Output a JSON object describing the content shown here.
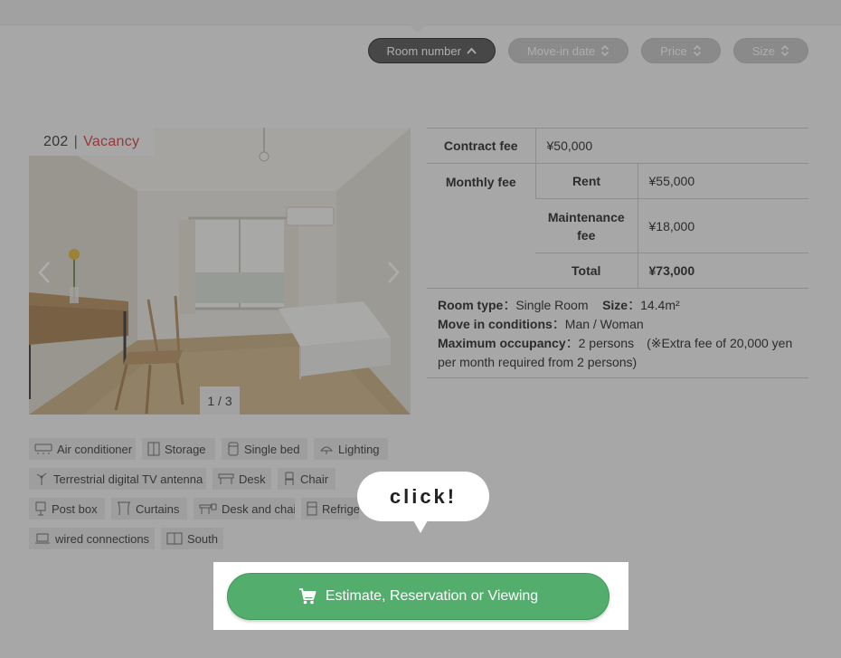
{
  "sort": {
    "items": [
      {
        "label": "Room number",
        "active": true
      },
      {
        "label": "Move-in date",
        "active": false
      },
      {
        "label": "Price",
        "active": false
      },
      {
        "label": "Size",
        "active": false
      }
    ]
  },
  "room": {
    "number": "202",
    "separator": "|",
    "status": "Vacancy",
    "photo_counter": "1 / 3"
  },
  "fees": {
    "contract_label": "Contract fee",
    "contract_value": "¥50,000",
    "monthly_label": "Monthly fee",
    "rent_label": "Rent",
    "rent_value": "¥55,000",
    "maintenance_label": "Maintenance fee",
    "maintenance_value": "¥18,000",
    "total_label": "Total",
    "total_value": "¥73,000"
  },
  "info": {
    "room_type_label": "Room type",
    "room_type_value": "Single Room",
    "size_label": "Size",
    "size_value": "14.4m²",
    "conditions_label": "Move in conditions",
    "conditions_value": "Man / Woman",
    "occupancy_label": "Maximum occupancy",
    "occupancy_value": "2 persons　(※Extra fee of 20,000 yen per month required from 2 persons)"
  },
  "amenities": {
    "rows": [
      [
        "Air conditioner",
        "Storage",
        "Single bed",
        "Lighting"
      ],
      [
        "Terrestrial digital TV antenna",
        "Desk",
        "Chair"
      ],
      [
        "Post box",
        "Curtains",
        "Desk and chair",
        "Refrigerator"
      ],
      [
        "wired connections",
        "South"
      ]
    ]
  },
  "cta": {
    "label": "Estimate, Reservation or Viewing"
  },
  "hint": {
    "text": "click!"
  },
  "colors": {
    "vacancy": "#d53a36",
    "cta": "#53ad6d",
    "active_sort": "#505050"
  }
}
